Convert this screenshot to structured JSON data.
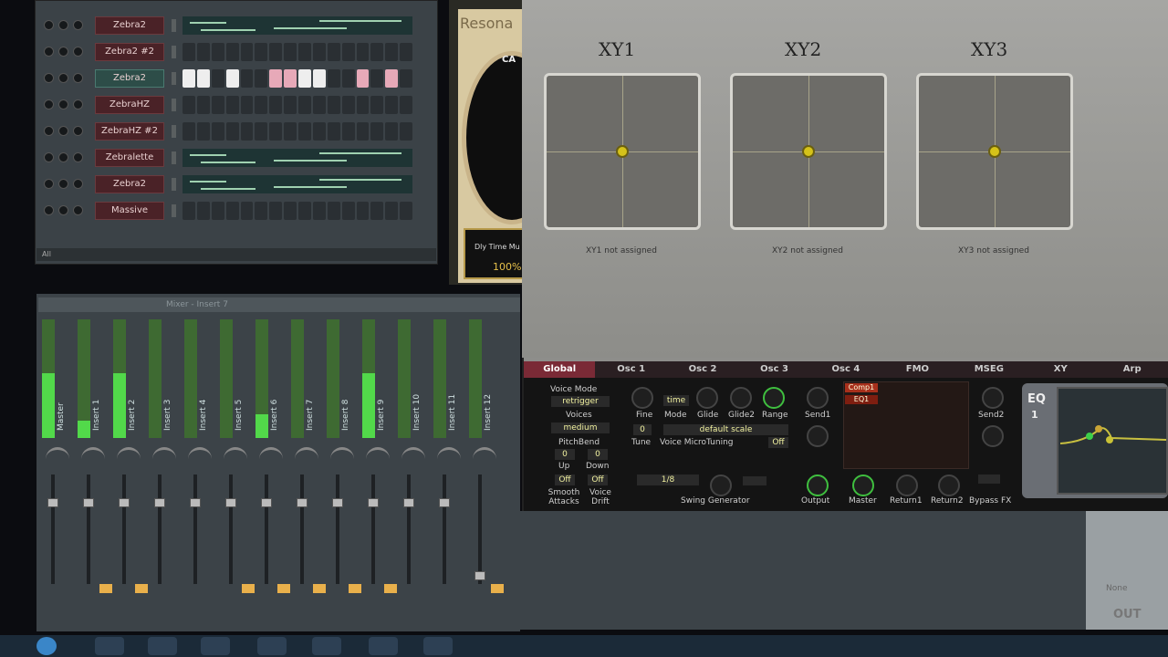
{
  "rack": {
    "channels": [
      {
        "name": "Zebra2",
        "selected": false,
        "kind": "roll"
      },
      {
        "name": "Zebra2 #2",
        "selected": false,
        "kind": "steps",
        "on": []
      },
      {
        "name": "Zebra2",
        "selected": true,
        "kind": "steps",
        "on": [
          0,
          1,
          3,
          6,
          7,
          8,
          9,
          12,
          14
        ],
        "pink": [
          6,
          7,
          12,
          14
        ]
      },
      {
        "name": "ZebraHZ",
        "selected": false,
        "kind": "steps",
        "on": []
      },
      {
        "name": "ZebraHZ #2",
        "selected": false,
        "kind": "steps",
        "on": []
      },
      {
        "name": "Zebralette",
        "selected": false,
        "kind": "roll"
      },
      {
        "name": "Zebra2",
        "selected": false,
        "kind": "roll"
      },
      {
        "name": "Massive",
        "selected": false,
        "kind": "steps",
        "on": []
      }
    ],
    "footer": "All"
  },
  "behind": {
    "title": "Resona",
    "dial_label": "CA",
    "delay_label": "Dly Time Mu",
    "delay_value": "100%"
  },
  "mixer": {
    "title": "Mixer - Insert 7",
    "tracks": [
      {
        "name": "Master",
        "level": 0.55,
        "fx": false
      },
      {
        "name": "Insert 1",
        "level": 0.15,
        "fx": true
      },
      {
        "name": "Insert 2",
        "level": 0.55,
        "fx": true
      },
      {
        "name": "Insert 3",
        "level": 0.0,
        "fx": false
      },
      {
        "name": "Insert 4",
        "level": 0.0,
        "fx": false
      },
      {
        "name": "Insert 5",
        "level": 0.0,
        "fx": true
      },
      {
        "name": "Insert 6",
        "level": 0.2,
        "fx": true
      },
      {
        "name": "Insert 7",
        "level": 0.0,
        "fx": true
      },
      {
        "name": "Insert 8",
        "level": 0.0,
        "fx": true
      },
      {
        "name": "Insert 9",
        "level": 0.55,
        "fx": true
      },
      {
        "name": "Insert 10",
        "level": 0.0,
        "fx": false
      },
      {
        "name": "Insert 11",
        "level": 0.0,
        "fx": false
      },
      {
        "name": "Insert 12",
        "level": 0.0,
        "fx": true
      }
    ],
    "out_label": "OUT",
    "none_label": "None"
  },
  "synth": {
    "xy": [
      {
        "title": "XY1",
        "assign": "XY1 not assigned"
      },
      {
        "title": "XY2",
        "assign": "XY2 not assigned"
      },
      {
        "title": "XY3",
        "assign": "XY3 not assigned"
      }
    ],
    "tabs": [
      "Global",
      "Osc 1",
      "Osc 2",
      "Osc 3",
      "Osc 4",
      "FMO",
      "MSEG",
      "XY",
      "Arp"
    ],
    "active_tab": "Global",
    "voice_mode_label": "Voice Mode",
    "voice_mode": "retrigger",
    "voices_label": "Voices",
    "voices": "medium",
    "pitchbend_label": "PitchBend",
    "pb_up": "0",
    "pb_down": "0",
    "up_label": "Up",
    "down_label": "Down",
    "smooth_val": "Off",
    "drift_val": "Off",
    "smooth_label": "Smooth Attacks",
    "drift_label": "Voice Drift",
    "fine_label": "Fine",
    "mode_label": "Mode",
    "mode_val": "time",
    "glide_label": "Glide",
    "glide2_label": "Glide2",
    "range_label": "Range",
    "send1_label": "Send1",
    "tune_val": "0",
    "tune_label": "Tune",
    "scale_val": "default scale",
    "micro_label": "Voice MicroTuning",
    "micro_off": "Off",
    "swing_val": "1/8",
    "swing_label": "Swing Generator",
    "output_label": "Output",
    "master_label": "Master",
    "return1_label": "Return1",
    "return2_label": "Return2",
    "bypass_label": "Bypass FX",
    "send2_label": "Send2",
    "comp": "Comp1",
    "eq": "EQ1",
    "eq_title": "EQ",
    "eq_num": "1"
  }
}
